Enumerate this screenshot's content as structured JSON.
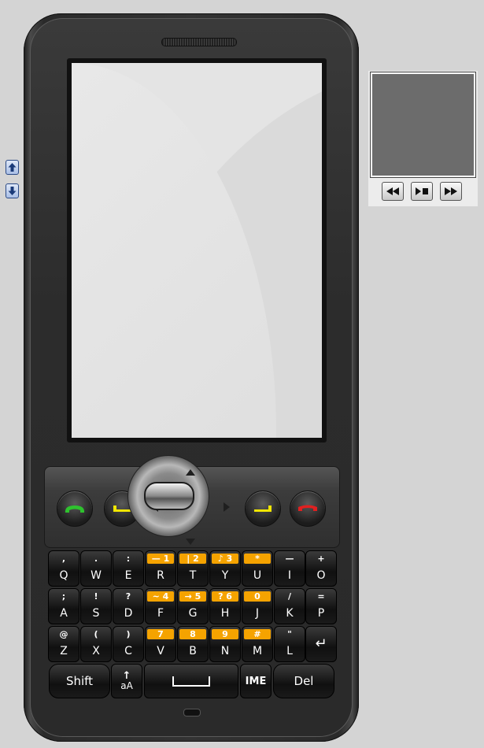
{
  "side_controls": {
    "up_icon": "arrow-up-icon",
    "down_icon": "arrow-down-icon",
    "accent": "#2b4a86"
  },
  "phone": {
    "call_key_color": "#2ec22e",
    "soft_key_color": "#f1e600",
    "end_key_color": "#e02020"
  },
  "keyboard": {
    "row1": [
      {
        "top": ",",
        "main": "Q"
      },
      {
        "top": ".",
        "main": "W"
      },
      {
        "top": ":",
        "main": "E"
      },
      {
        "badge": "— 1",
        "main": "R"
      },
      {
        "badge": "| 2",
        "main": "T"
      },
      {
        "badge": "♪ 3",
        "main": "Y"
      },
      {
        "badge": "*",
        "main": "U"
      },
      {
        "top": "—",
        "main": "I"
      },
      {
        "top": "+",
        "main": "O"
      }
    ],
    "row2": [
      {
        "top": ";",
        "main": "A"
      },
      {
        "top": "!",
        "main": "S"
      },
      {
        "top": "?",
        "main": "D"
      },
      {
        "badge": "~ 4",
        "main": "F"
      },
      {
        "badge": "→ 5",
        "main": "G"
      },
      {
        "badge": "? 6",
        "main": "H"
      },
      {
        "badge": "0",
        "main": "J"
      },
      {
        "top": "/",
        "main": "K"
      },
      {
        "top": "=",
        "main": "P"
      }
    ],
    "row3": [
      {
        "top": "@",
        "main": "Z"
      },
      {
        "top": "(",
        "main": "X"
      },
      {
        "top": ")",
        "main": "C"
      },
      {
        "badge": "7",
        "main": "V"
      },
      {
        "badge": "8",
        "main": "B"
      },
      {
        "badge": "9",
        "main": "N"
      },
      {
        "badge": "#",
        "main": "M"
      },
      {
        "top": "\"",
        "main": "L"
      },
      {
        "top": "",
        "main": "↵"
      }
    ],
    "shift_label": "Shift",
    "case_top": "↑",
    "case_label": "aA",
    "ime_label": "IME",
    "del_label": "Del",
    "badge_color": "#f5a300"
  },
  "media": {
    "rewind_icon": "rewind-icon",
    "play_stop_icon": "play-stop-icon",
    "fast_forward_icon": "fast-forward-icon"
  }
}
